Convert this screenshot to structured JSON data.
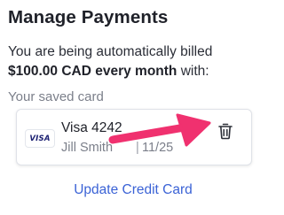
{
  "page": {
    "title": "Manage Payments"
  },
  "billing": {
    "prefix": "You are being automatically billed",
    "amount": "$100.00 CAD every month",
    "suffix": " with:"
  },
  "saved_card": {
    "section_label": "Your saved card",
    "brand_logo_text": "VISA",
    "name": "Visa 4242",
    "holder": "Jill Smith",
    "separator": "|",
    "expiry": "11/25",
    "delete_icon": "trash-icon"
  },
  "annotation": {
    "arrow_color": "#f0316f"
  },
  "actions": {
    "update_label": "Update Credit Card"
  },
  "colors": {
    "link": "#3b63d6",
    "muted_text": "#7b7f8a",
    "visa_blue": "#1a1f71"
  }
}
